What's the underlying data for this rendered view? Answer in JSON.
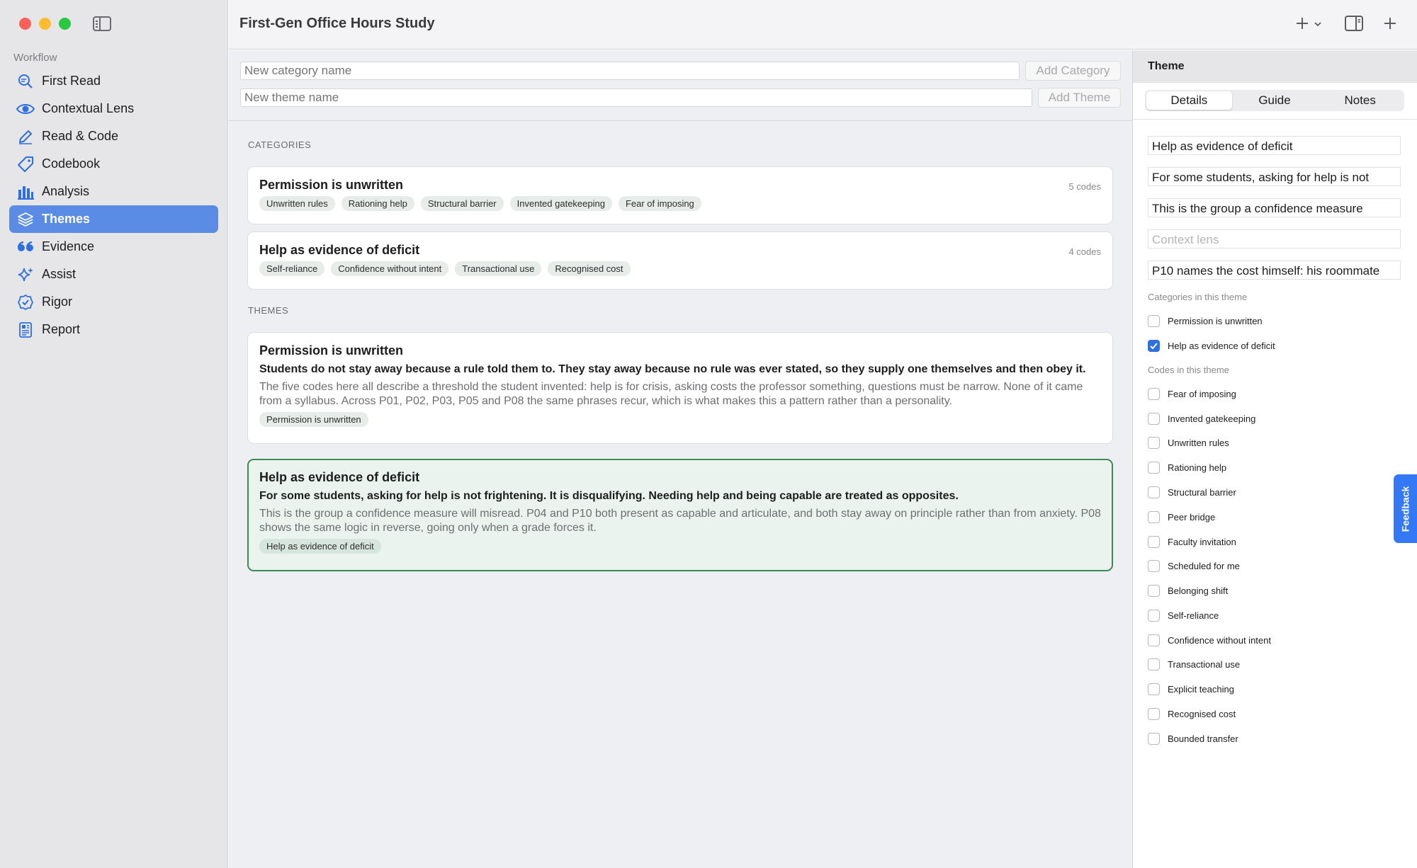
{
  "app": {
    "title": "First-Gen Office Hours Study"
  },
  "sidebar": {
    "section_label": "Workflow",
    "items": [
      {
        "label": "First Read",
        "icon": "magnifier-icon"
      },
      {
        "label": "Contextual Lens",
        "icon": "eye-icon"
      },
      {
        "label": "Read & Code",
        "icon": "pencil-icon"
      },
      {
        "label": "Codebook",
        "icon": "tag-icon"
      },
      {
        "label": "Analysis",
        "icon": "bar-chart-icon"
      },
      {
        "label": "Themes",
        "icon": "layers-icon",
        "active": true
      },
      {
        "label": "Evidence",
        "icon": "quote-icon"
      },
      {
        "label": "Assist",
        "icon": "sparkle-icon"
      },
      {
        "label": "Rigor",
        "icon": "badge-check-icon"
      },
      {
        "label": "Report",
        "icon": "report-icon"
      }
    ]
  },
  "forms": {
    "category_placeholder": "New category name",
    "add_category": "Add Category",
    "theme_placeholder": "New theme name",
    "add_theme": "Add Theme"
  },
  "categories": {
    "heading": "CATEGORIES",
    "items": [
      {
        "name": "Permission is unwritten",
        "count": "5 codes",
        "codes": [
          "Unwritten rules",
          "Rationing help",
          "Structural barrier",
          "Invented gatekeeping",
          "Fear of imposing"
        ]
      },
      {
        "name": "Help as evidence of deficit",
        "count": "4 codes",
        "codes": [
          "Self-reliance",
          "Confidence without intent",
          "Transactional use",
          "Recognised cost"
        ]
      }
    ]
  },
  "themes": {
    "heading": "THEMES",
    "items": [
      {
        "name": "Permission is unwritten",
        "claim": "Students do not stay away because a rule told them to. They stay away because no rule was ever stated, so they supply one themselves and then obey it.",
        "description": "The five codes here all describe a threshold the student invented: help is for crisis, asking costs the professor something, questions must be narrow. None of it came from a syllabus. Across P01, P02, P03, P05 and P08 the same phrases recur, which is what makes this a pattern rather than a personality.",
        "category": "Permission is unwritten"
      },
      {
        "name": "Help as evidence of deficit",
        "claim": "For some students, asking for help is not frightening. It is disqualifying. Needing help and being capable are treated as opposites.",
        "description": "This is the group a confidence measure will misread. P04 and P10 both present as capable and articulate, and both stay away on principle rather than from anxiety. P08 shows the same logic in reverse, going only when a grade forces it.",
        "category": "Help as evidence of deficit",
        "selected": true
      }
    ]
  },
  "panel": {
    "title": "Theme",
    "tabs": [
      "Details",
      "Guide",
      "Notes"
    ],
    "active_tab": "Details",
    "fields": {
      "name": "Help as evidence of deficit",
      "claim": "For some students, asking for help is not",
      "description": "This is the group a confidence measure",
      "context_lens_placeholder": "Context lens",
      "evidence": "P10 names the cost himself: his roommate"
    },
    "categories_label": "Categories in this theme",
    "categories": [
      {
        "label": "Permission is unwritten",
        "checked": false
      },
      {
        "label": "Help as evidence of deficit",
        "checked": true
      }
    ],
    "codes_label": "Codes in this theme",
    "codes": [
      {
        "label": "Fear of imposing",
        "checked": false
      },
      {
        "label": "Invented gatekeeping",
        "checked": false
      },
      {
        "label": "Unwritten rules",
        "checked": false
      },
      {
        "label": "Rationing help",
        "checked": false
      },
      {
        "label": "Structural barrier",
        "checked": false
      },
      {
        "label": "Peer bridge",
        "checked": false
      },
      {
        "label": "Faculty invitation",
        "checked": false
      },
      {
        "label": "Scheduled for me",
        "checked": false
      },
      {
        "label": "Belonging shift",
        "checked": false
      },
      {
        "label": "Self-reliance",
        "checked": false
      },
      {
        "label": "Confidence without intent",
        "checked": false
      },
      {
        "label": "Transactional use",
        "checked": false
      },
      {
        "label": "Explicit teaching",
        "checked": false
      },
      {
        "label": "Recognised cost",
        "checked": false
      },
      {
        "label": "Bounded transfer",
        "checked": false
      }
    ],
    "feedback": "Feedback"
  },
  "colors": {
    "accent": "#5b8ce5",
    "selected_border": "#3e8a57",
    "checkbox_on": "#2f6fe0",
    "feedback": "#3478f6"
  }
}
